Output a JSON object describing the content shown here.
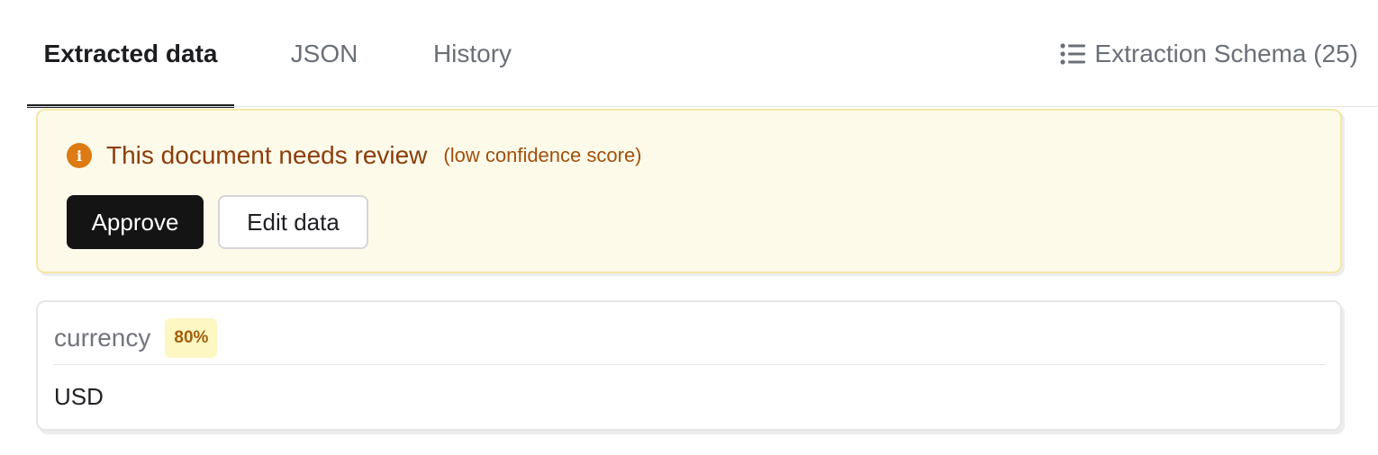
{
  "tabs": {
    "extracted": "Extracted data",
    "json": "JSON",
    "history": "History",
    "active": "extracted"
  },
  "schema_button": {
    "label": "Extraction Schema (25)",
    "icon": "list-icon"
  },
  "review": {
    "icon": "info-icon",
    "title": "This document needs review",
    "subtitle": "(low confidence score)",
    "approve_label": "Approve",
    "edit_label": "Edit data"
  },
  "field": {
    "name": "currency",
    "confidence": "80%",
    "value": "USD"
  },
  "colors": {
    "warning_bg": "#fefaea",
    "warning_border": "#f6e6a6",
    "warning_text": "#8b3e0b",
    "info_icon": "#dd7a12",
    "badge_bg": "#fdf7c3",
    "badge_text": "#a1600e",
    "primary_button": "#141414"
  }
}
